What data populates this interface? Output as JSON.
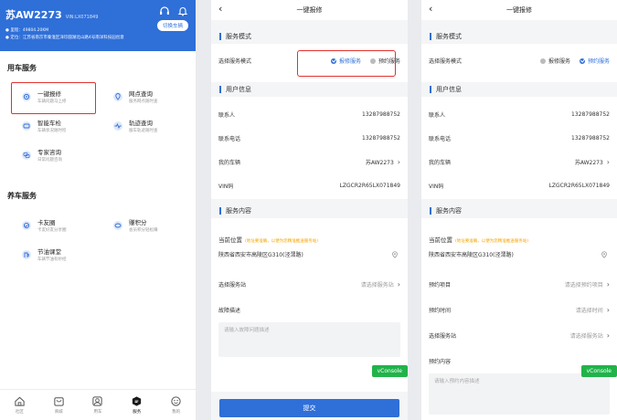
{
  "s1": {
    "plate": "苏AW2273",
    "vin_small": "VIN:LX071849",
    "switch_btn": "切换车辆",
    "mileage": "● 里程：49804.20KM",
    "location": "● 定位：江苏省南京市秦淮区洋珍圆湖北山路4号南洋科技园创意",
    "section1": "用车服务",
    "section2": "养车服务",
    "services": [
      {
        "title": "一键报修",
        "sub": "车辆问题马上修",
        "icon": "repair-icon"
      },
      {
        "title": "网点查询",
        "sub": "服务网点随时查",
        "icon": "location-pin-icon"
      },
      {
        "title": "智能车检",
        "sub": "车辆状况随时检",
        "icon": "car-check-icon"
      },
      {
        "title": "轨迹查询",
        "sub": "服车轨迹随时查",
        "icon": "trajectory-icon"
      },
      {
        "title": "专家咨询",
        "sub": "日常问题咨询",
        "icon": "expert-icon"
      },
      {
        "title": "卡友圈",
        "sub": "卡友好友分享圈",
        "icon": "circle-icon"
      },
      {
        "title": "赚积分",
        "sub": "会员积分轻松赚",
        "icon": "points-icon"
      },
      {
        "title": "节油课堂",
        "sub": "车辆节油有妙招",
        "icon": "fuel-icon"
      }
    ],
    "tabs": [
      {
        "label": "社区",
        "icon": "home-icon"
      },
      {
        "label": "商城",
        "icon": "shop-icon"
      },
      {
        "label": "用车",
        "icon": "car-icon"
      },
      {
        "label": "服务",
        "icon": "service-icon"
      },
      {
        "label": "我的",
        "icon": "profile-icon"
      }
    ]
  },
  "form": {
    "nav_title": "一键报修",
    "service_mode_title": "服务模式",
    "select_mode_label": "选择服务模式",
    "opt_urgent": "报修服务",
    "opt_appointment": "预约服务",
    "user_info_title": "用户信息",
    "contact_label": "联系人",
    "contact_value": "13287988752",
    "phone_label": "联系电话",
    "phone_value": "13287988752",
    "vehicle_label": "我的车辆",
    "vehicle_value": "苏AW2273",
    "vin_label": "VIN码",
    "vin_value": "LZGCR2R65LX071849",
    "content_title": "服务内容",
    "current_loc_label": "当前位置",
    "current_loc_hint": "(地址要准确，以便为您精准推送服务站)",
    "address": "陕西省西安市高陵区G310(泾渭路)",
    "select_station_label": "选择服务站",
    "select_station_ph": "请选择服务站",
    "fault_label": "故障描述",
    "fault_ph": "请输入故障问题描述",
    "submit": "提交",
    "vconsole": "vConsole",
    "project_label": "预约项目",
    "project_ph": "请选择预约项目",
    "time_label": "预约时间",
    "time_ph": "请选择时间",
    "content_label": "预约内容",
    "content_ph": "请输入预约内容描述"
  }
}
